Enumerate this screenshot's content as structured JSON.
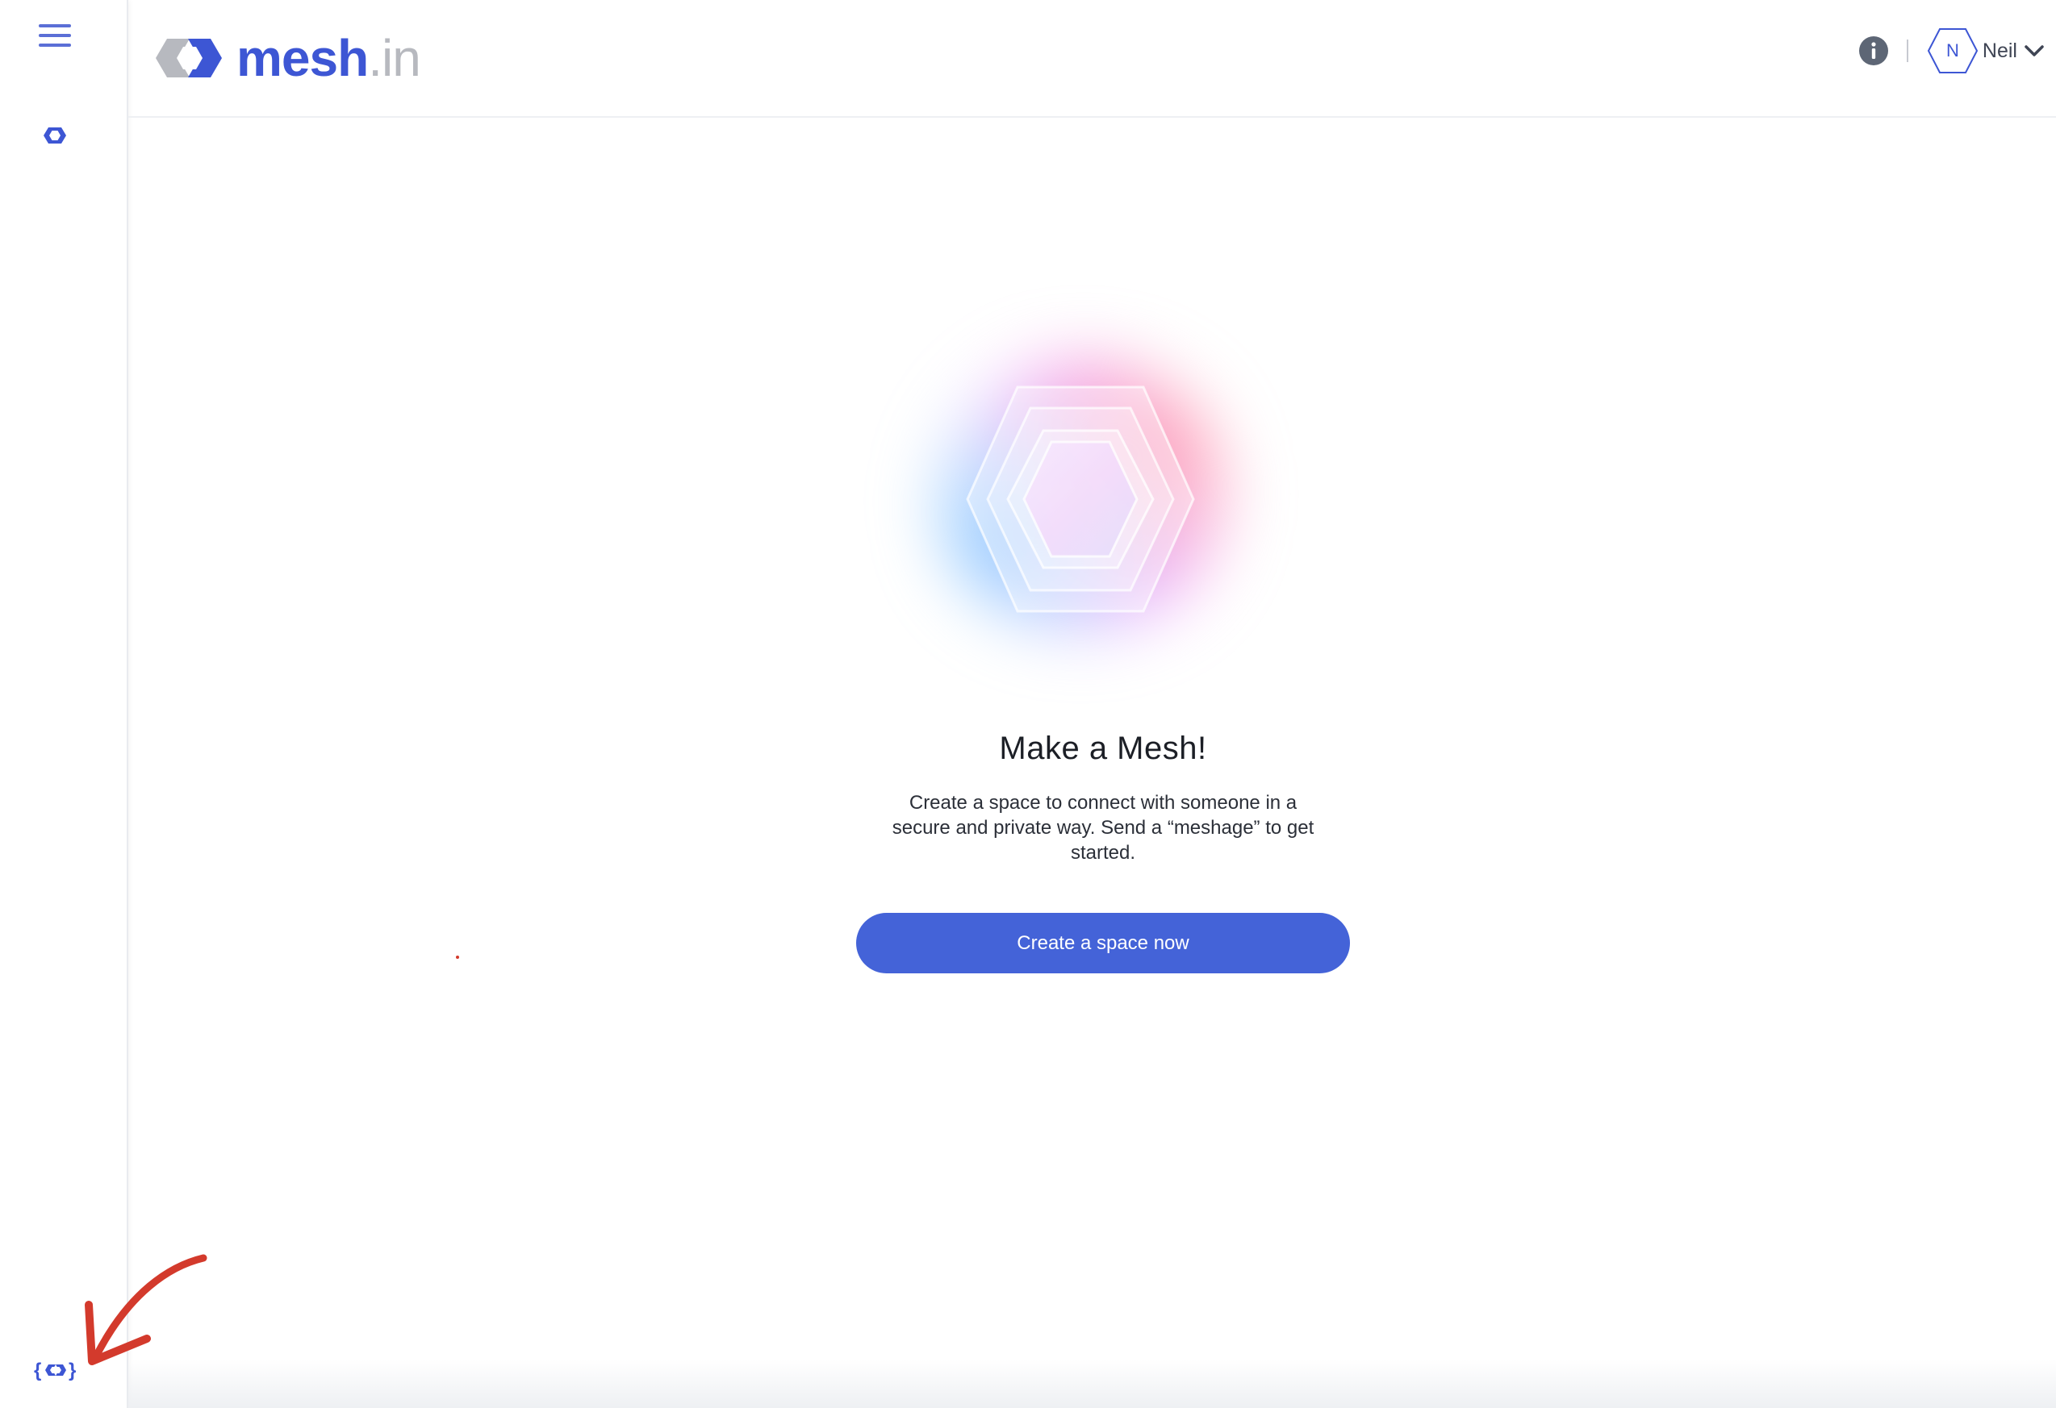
{
  "app": {
    "brand": "mesh",
    "brand_tld": ".in",
    "accent_color": "#4463d8",
    "logo_color": "#3d56d4"
  },
  "header": {
    "info_icon": "info-icon",
    "user": {
      "initial": "N",
      "name": "Neil"
    }
  },
  "sidebar": {
    "menu_icon": "hamburger-menu-icon",
    "nav_icon": "mesh-link-icon",
    "footer_icon": "mesh-dev-icon"
  },
  "main": {
    "title": "Make a Mesh!",
    "description": "Create a space to connect with someone in a secure and private way.  Send a “meshage” to get started.",
    "cta_label": "Create a space now"
  },
  "annotation": {
    "color": "#d33a2c"
  }
}
